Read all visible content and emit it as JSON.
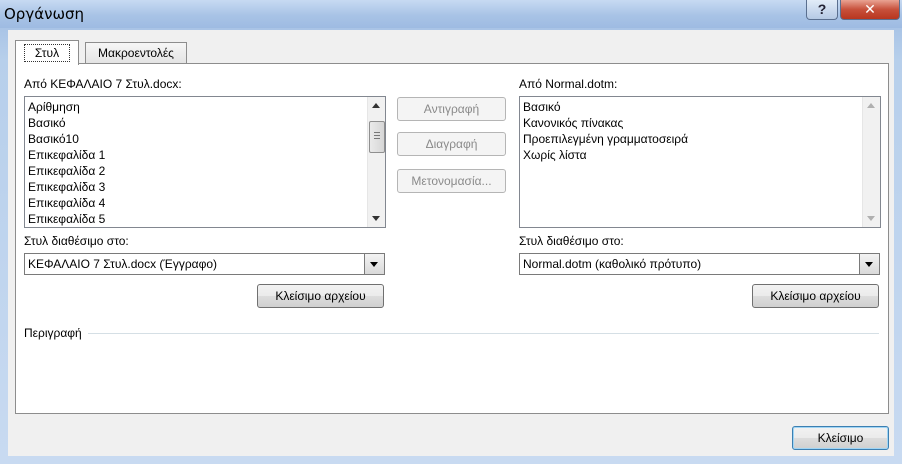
{
  "window": {
    "title": "Οργάνωση",
    "help_label": "?",
    "close_label": "✕"
  },
  "tabs": [
    {
      "label": "Στυλ"
    },
    {
      "label": "Μακροεντολές"
    }
  ],
  "left": {
    "source_label": "Από ΚΕΦΑΛΑΙΟ 7 Στυλ.docx:",
    "items": [
      "Αρίθμηση",
      "Βασικό",
      "Βασικό10",
      "Επικεφαλίδα 1",
      "Επικεφαλίδα 2",
      "Επικεφαλίδα 3",
      "Επικεφαλίδα 4",
      "Επικεφαλίδα 5"
    ],
    "available_label": "Στυλ διαθέσιμο στο:",
    "available_value": "ΚΕΦΑΛΑΙΟ 7 Στυλ.docx (Έγγραφο)",
    "close_file_label": "Κλείσιμο αρχείου"
  },
  "middle": {
    "copy_label": "Αντιγραφή",
    "delete_label": "Διαγραφή",
    "rename_label": "Μετονομασία..."
  },
  "right": {
    "source_label": "Από Normal.dotm:",
    "items": [
      "Βασικό",
      "Κανονικός πίνακας",
      "Προεπιλεγμένη γραμματοσειρά",
      "Χωρίς λίστα"
    ],
    "available_label": "Στυλ διαθέσιμο στο:",
    "available_value": "Normal.dotm (καθολικό πρότυπο)",
    "close_file_label": "Κλείσιμο αρχείου"
  },
  "description": {
    "label": "Περιγραφή"
  },
  "footer": {
    "close_label": "Κλείσιμο"
  }
}
